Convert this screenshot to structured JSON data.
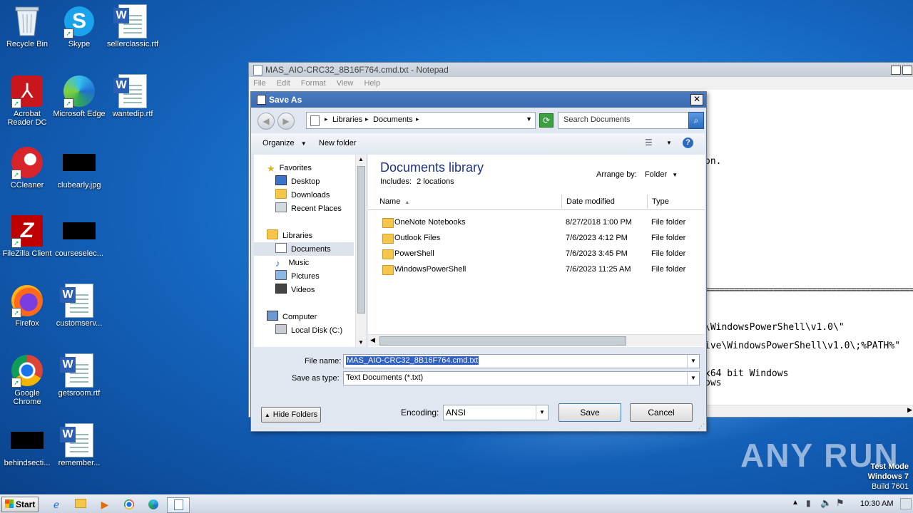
{
  "desktop": {
    "icons": [
      {
        "label": "Recycle Bin"
      },
      {
        "label": "Skype"
      },
      {
        "label": "sellerclassic.rtf"
      },
      {
        "label": "Acrobat Reader DC"
      },
      {
        "label": "Microsoft Edge"
      },
      {
        "label": "wantedip.rtf"
      },
      {
        "label": "CCleaner"
      },
      {
        "label": "clubearly.jpg"
      },
      {
        "label": "FileZilla Client"
      },
      {
        "label": "courseselec..."
      },
      {
        "label": "Firefox"
      },
      {
        "label": "customserv..."
      },
      {
        "label": "Google Chrome"
      },
      {
        "label": "getsroom.rtf"
      },
      {
        "label": "behindsecti..."
      },
      {
        "label": "remember..."
      }
    ]
  },
  "notepad": {
    "title": "MAS_AIO-CRC32_8B16F764.cmd.txt - Notepad",
    "menu": [
      "File",
      "Edit",
      "Format",
      "View",
      "Help"
    ],
    "lines": [
      "on.",
      "=================================================",
      "\\WindowsPowerShell\\v1.0\\\"",
      "ive\\WindowsPowerShell\\v1.0\\;%PATH%\"",
      "x64 bit Windows",
      "ows"
    ]
  },
  "save_as": {
    "title": "Save As",
    "breadcrumb": [
      "Libraries",
      "Documents"
    ],
    "search_placeholder": "Search Documents",
    "toolbar": {
      "organize": "Organize",
      "new_folder": "New folder"
    },
    "nav": {
      "favorites": "Favorites",
      "desktop": "Desktop",
      "downloads": "Downloads",
      "recent": "Recent Places",
      "libraries": "Libraries",
      "documents": "Documents",
      "music": "Music",
      "pictures": "Pictures",
      "videos": "Videos",
      "computer": "Computer",
      "local_disk": "Local Disk (C:)"
    },
    "library_title": "Documents library",
    "includes_label": "Includes:",
    "includes_link": "2 locations",
    "arrange_by_label": "Arrange by:",
    "arrange_by_value": "Folder",
    "columns": {
      "name": "Name",
      "date": "Date modified",
      "type": "Type"
    },
    "files": [
      {
        "name": "OneNote Notebooks",
        "date": "8/27/2018 1:00 PM",
        "type": "File folder"
      },
      {
        "name": "Outlook Files",
        "date": "7/6/2023 4:12 PM",
        "type": "File folder"
      },
      {
        "name": "PowerShell",
        "date": "7/6/2023 3:45 PM",
        "type": "File folder"
      },
      {
        "name": "WindowsPowerShell",
        "date": "7/6/2023 11:25 AM",
        "type": "File folder"
      }
    ],
    "file_name_label": "File name:",
    "file_name_value": "MAS_AIO-CRC32_8B16F764.cmd.txt",
    "save_type_label": "Save as type:",
    "save_type_value": "Text Documents (*.txt)",
    "encoding_label": "Encoding:",
    "encoding_value": "ANSI",
    "hide_folders": "Hide Folders",
    "save_button": "Save",
    "cancel_button": "Cancel"
  },
  "watermark": {
    "brand": "ANY RUN",
    "test_mode": "Test Mode",
    "os": "Windows 7",
    "build": "Build 7601"
  },
  "taskbar": {
    "start_label": "Start",
    "clock": "10:30 AM"
  }
}
